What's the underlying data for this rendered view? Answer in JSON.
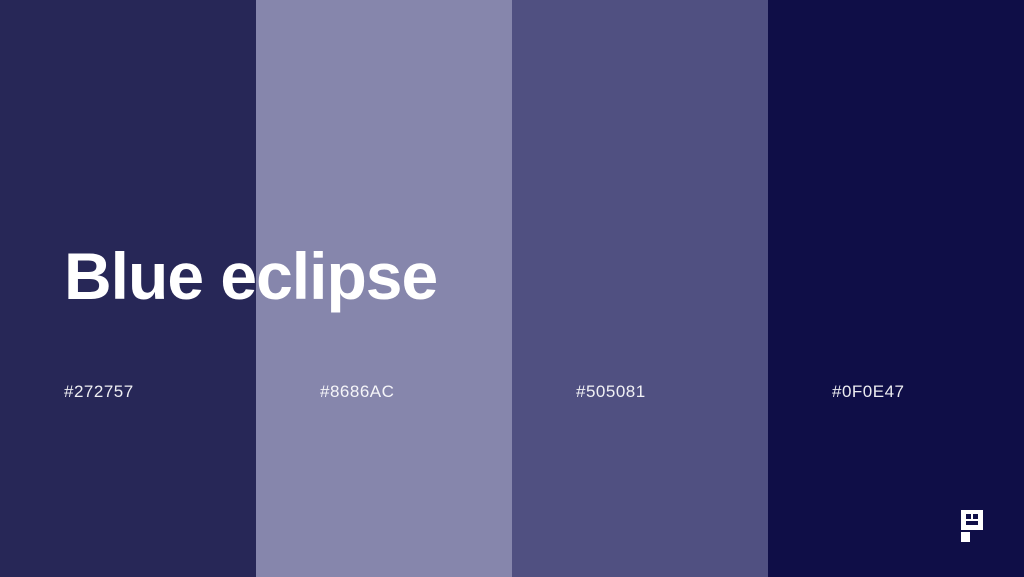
{
  "palette": {
    "title": "Blue eclipse",
    "swatches": [
      {
        "code": "#272757",
        "color": "#272757"
      },
      {
        "code": "#8686AC",
        "color": "#8686AC"
      },
      {
        "code": "#505081",
        "color": "#505081"
      },
      {
        "code": "#0F0E47",
        "color": "#0F0E47"
      }
    ]
  },
  "icons": {
    "brand": "brand-logo-icon"
  }
}
